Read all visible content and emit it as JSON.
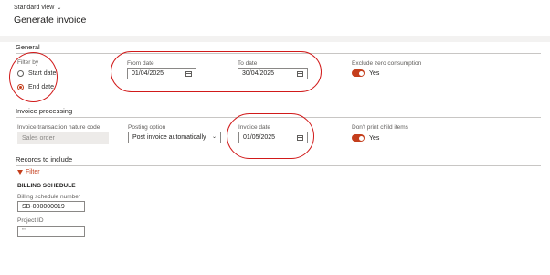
{
  "header": {
    "view_label": "Standard view",
    "title": "Generate invoice"
  },
  "general": {
    "heading": "General",
    "filter_by": {
      "label": "Filter by",
      "options": [
        "Start date",
        "End date"
      ],
      "selected": "End date"
    },
    "from_date": {
      "label": "From date",
      "value": "01/04/2025"
    },
    "to_date": {
      "label": "To date",
      "value": "30/04/2025"
    },
    "exclude_zero": {
      "label": "Exclude zero consumption",
      "value": "Yes"
    }
  },
  "invoice_processing": {
    "heading": "Invoice processing",
    "nature_code": {
      "label": "Invoice transaction nature code",
      "value": "Sales order"
    },
    "posting_option": {
      "label": "Posting option",
      "value": "Post invoice automatically"
    },
    "invoice_date": {
      "label": "Invoice date",
      "value": "01/05/2025"
    },
    "dont_print": {
      "label": "Don't print child items",
      "value": "Yes"
    }
  },
  "records": {
    "heading": "Records to include",
    "filter_label": "Filter",
    "group_title": "BILLING SCHEDULE",
    "billing_schedule": {
      "label": "Billing schedule number",
      "value": "SB-000000019"
    },
    "project_id": {
      "label": "Project ID",
      "value": "\"\""
    }
  },
  "colors": {
    "accent": "#c43e1c",
    "annotation": "#d11a1a",
    "band": "#f3f2f1"
  }
}
